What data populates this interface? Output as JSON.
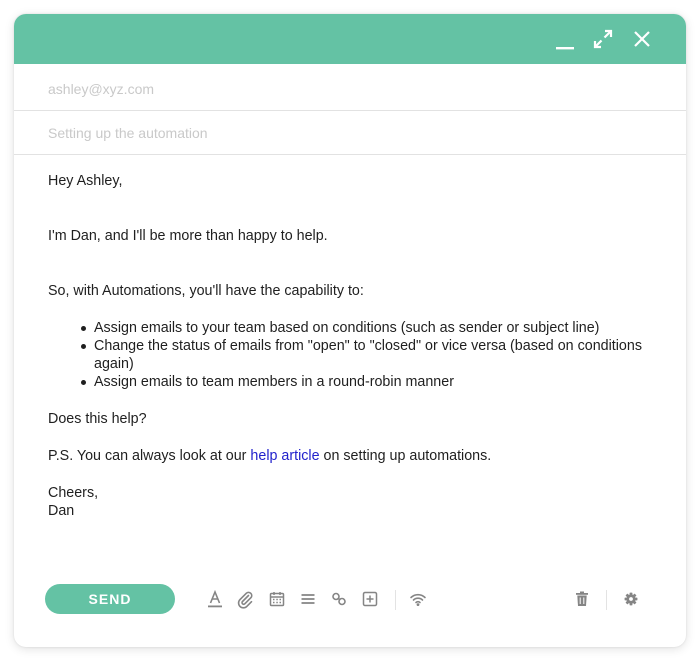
{
  "window": {
    "titlebar_color": "#64c2a4",
    "controls": {
      "minimize_icon": "minimize-icon",
      "expand_icon": "expand-icon",
      "close_icon": "close-icon"
    }
  },
  "compose": {
    "to_placeholder": "ashley@xyz.com",
    "subject_placeholder": "Setting up the automation"
  },
  "message": {
    "greeting": "Hey Ashley,",
    "intro": "I'm Dan, and I'll be more than happy to help.",
    "lead": "So, with Automations, you'll have the capability to:",
    "bullets": [
      "Assign emails to your team based on conditions (such as sender or subject line)",
      "Change the status of emails from \"open\" to \"closed\" or vice versa (based on conditions again)",
      "Assign emails to team members in a round-robin manner"
    ],
    "question": "Does this help?",
    "ps_before": "P.S. You can always look at our ",
    "ps_link": "help article",
    "ps_after": " on setting up automations.",
    "signoff": "Cheers,",
    "signature": "Dan",
    "link_color": "#2222cc"
  },
  "toolbar": {
    "send_label": "SEND",
    "accent_color": "#64c2a4",
    "icons": [
      "text-format-icon",
      "paperclip-icon",
      "calendar-icon",
      "list-icon",
      "link-icon",
      "add-box-icon",
      "signal-icon",
      "trash-icon",
      "gear-icon"
    ]
  }
}
